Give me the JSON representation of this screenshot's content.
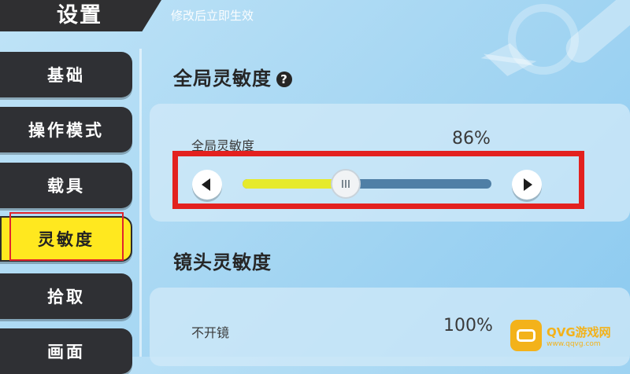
{
  "header": {
    "title": "设置",
    "hint": "修改后立即生效"
  },
  "sidebar": {
    "items": [
      {
        "label": "基础"
      },
      {
        "label": "操作模式"
      },
      {
        "label": "载具"
      },
      {
        "label": "灵敏度",
        "active": true
      },
      {
        "label": "拾取"
      },
      {
        "label": "画面"
      }
    ]
  },
  "sections": {
    "global": {
      "title": "全局灵敏度",
      "help_icon": "?",
      "slider": {
        "label": "全局灵敏度",
        "value_text": "86%",
        "value": 0.86
      }
    },
    "camera": {
      "title": "镜头灵敏度",
      "row": {
        "label": "不开镜",
        "value_text": "100%"
      }
    }
  },
  "watermark": {
    "brand": "QVG游戏网",
    "sub": "www.qqvg.com"
  },
  "colors": {
    "accent_yellow": "#ffe81f",
    "highlight_red": "#e3211f",
    "nav_dark": "#2f3034",
    "track_fill": "#e6ea2c",
    "track_bg": "#4f7fa6"
  }
}
